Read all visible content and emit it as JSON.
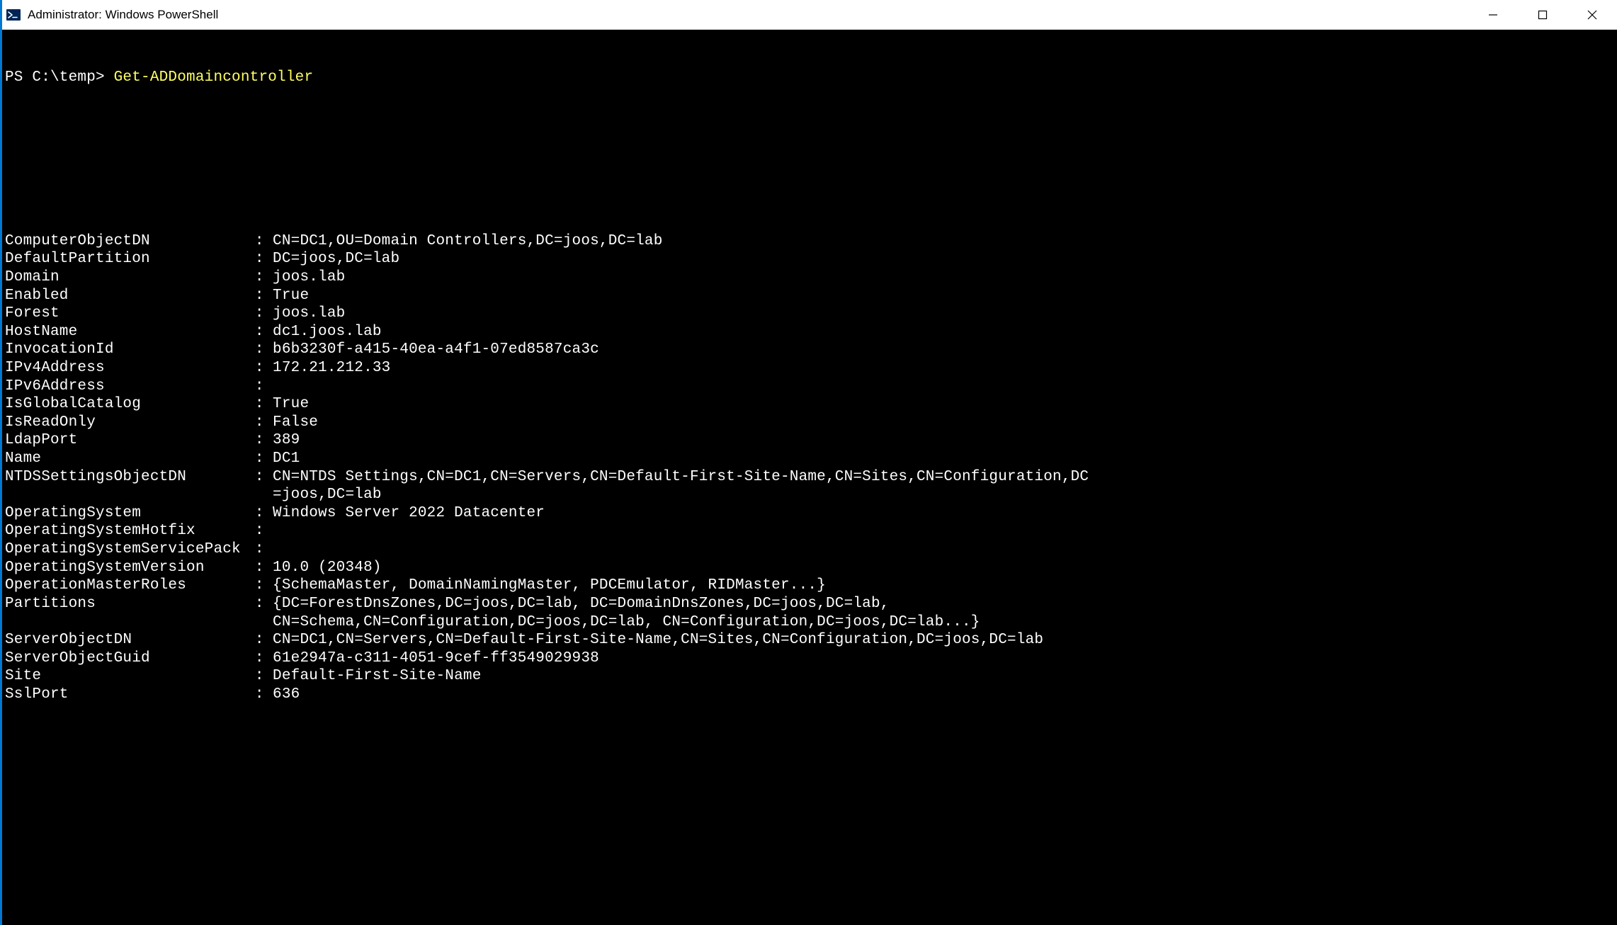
{
  "titlebar": {
    "title": "Administrator: Windows PowerShell"
  },
  "prompt": {
    "ps": "PS C:\\temp> ",
    "command": "Get-ADDomaincontroller"
  },
  "output": {
    "rows": [
      {
        "key": "ComputerObjectDN",
        "sep": ": ",
        "val": "CN=DC1,OU=Domain Controllers,DC=joos,DC=lab"
      },
      {
        "key": "DefaultPartition",
        "sep": ": ",
        "val": "DC=joos,DC=lab"
      },
      {
        "key": "Domain",
        "sep": ": ",
        "val": "joos.lab"
      },
      {
        "key": "Enabled",
        "sep": ": ",
        "val": "True"
      },
      {
        "key": "Forest",
        "sep": ": ",
        "val": "joos.lab"
      },
      {
        "key": "HostName",
        "sep": ": ",
        "val": "dc1.joos.lab"
      },
      {
        "key": "InvocationId",
        "sep": ": ",
        "val": "b6b3230f-a415-40ea-a4f1-07ed8587ca3c"
      },
      {
        "key": "IPv4Address",
        "sep": ": ",
        "val": "172.21.212.33"
      },
      {
        "key": "IPv6Address",
        "sep": ": ",
        "val": ""
      },
      {
        "key": "IsGlobalCatalog",
        "sep": ": ",
        "val": "True"
      },
      {
        "key": "IsReadOnly",
        "sep": ": ",
        "val": "False"
      },
      {
        "key": "LdapPort",
        "sep": ": ",
        "val": "389"
      },
      {
        "key": "Name",
        "sep": ": ",
        "val": "DC1"
      },
      {
        "key": "NTDSSettingsObjectDN",
        "sep": ": ",
        "val": "CN=NTDS Settings,CN=DC1,CN=Servers,CN=Default-First-Site-Name,CN=Sites,CN=Configuration,DC",
        "cont": "=joos,DC=lab"
      },
      {
        "key": "OperatingSystem",
        "sep": ": ",
        "val": "Windows Server 2022 Datacenter"
      },
      {
        "key": "OperatingSystemHotfix",
        "sep": ": ",
        "val": ""
      },
      {
        "key": "OperatingSystemServicePack",
        "sep": ": ",
        "val": ""
      },
      {
        "key": "OperatingSystemVersion",
        "sep": ": ",
        "val": "10.0 (20348)"
      },
      {
        "key": "OperationMasterRoles",
        "sep": ": ",
        "val": "{SchemaMaster, DomainNamingMaster, PDCEmulator, RIDMaster...}"
      },
      {
        "key": "Partitions",
        "sep": ": ",
        "val": "{DC=ForestDnsZones,DC=joos,DC=lab, DC=DomainDnsZones,DC=joos,DC=lab,",
        "cont": "CN=Schema,CN=Configuration,DC=joos,DC=lab, CN=Configuration,DC=joos,DC=lab...}"
      },
      {
        "key": "ServerObjectDN",
        "sep": ": ",
        "val": "CN=DC1,CN=Servers,CN=Default-First-Site-Name,CN=Sites,CN=Configuration,DC=joos,DC=lab"
      },
      {
        "key": "ServerObjectGuid",
        "sep": ": ",
        "val": "61e2947a-c311-4051-9cef-ff3549029938"
      },
      {
        "key": "Site",
        "sep": ": ",
        "val": "Default-First-Site-Name"
      },
      {
        "key": "SslPort",
        "sep": ": ",
        "val": "636"
      }
    ]
  }
}
